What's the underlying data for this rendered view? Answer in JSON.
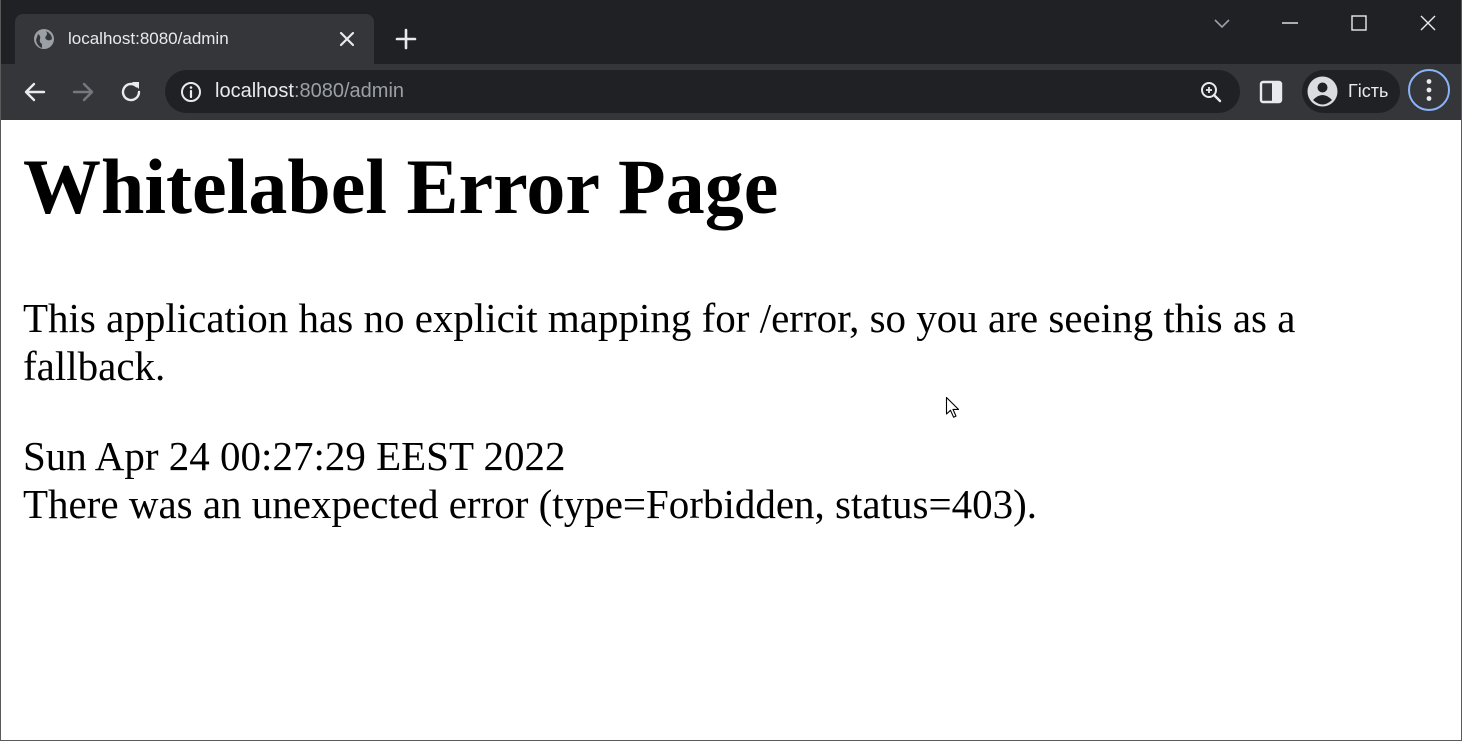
{
  "browser": {
    "tab": {
      "title": "localhost:8080/admin",
      "favicon": "globe-icon"
    },
    "address_bar": {
      "url_host": "localhost",
      "url_rest": ":8080/admin"
    },
    "profile": {
      "label": "Гість"
    },
    "colors": {
      "tabstrip_bg": "#202124",
      "toolbar_bg": "#35363a",
      "menu_ring": "#8ab4f8"
    }
  },
  "page": {
    "title": "Whitelabel Error Page",
    "message": "This application has no explicit mapping for /error, so you are seeing this as a fallback.",
    "timestamp": "Sun Apr 24 00:27:29 EEST 2022",
    "error_detail": "There was an unexpected error (type=Forbidden, status=403)."
  }
}
